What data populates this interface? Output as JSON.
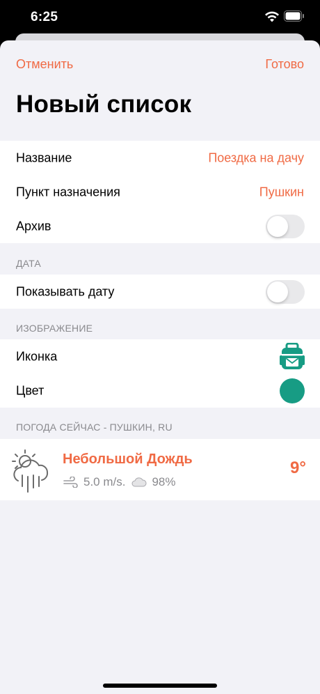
{
  "status_bar": {
    "time": "6:25"
  },
  "nav": {
    "cancel_label": "Отменить",
    "done_label": "Готово"
  },
  "title": "Новый список",
  "fields": {
    "name_label": "Название",
    "name_value": "Поездка на дачу",
    "destination_label": "Пункт назначения",
    "destination_value": "Пушкин",
    "archive_label": "Архив",
    "archive_on": false
  },
  "date_section": {
    "header": "ДАТА",
    "show_date_label": "Показывать дату",
    "show_date_on": false
  },
  "image_section": {
    "header": "ИЗОБРАЖЕНИЕ",
    "icon_label": "Иконка",
    "icon_name": "backpack-icon",
    "color_label": "Цвет",
    "color_value": "#179c84"
  },
  "weather": {
    "header": "ПОГОДА СЕЙЧАС - ПУШКИН, RU",
    "description": "Небольшой Дождь",
    "wind": "5.0 m/s.",
    "humidity": "98%",
    "temperature": "9°"
  },
  "colors": {
    "accent": "#f06a44",
    "teal": "#179c84",
    "background": "#f2f2f7"
  }
}
